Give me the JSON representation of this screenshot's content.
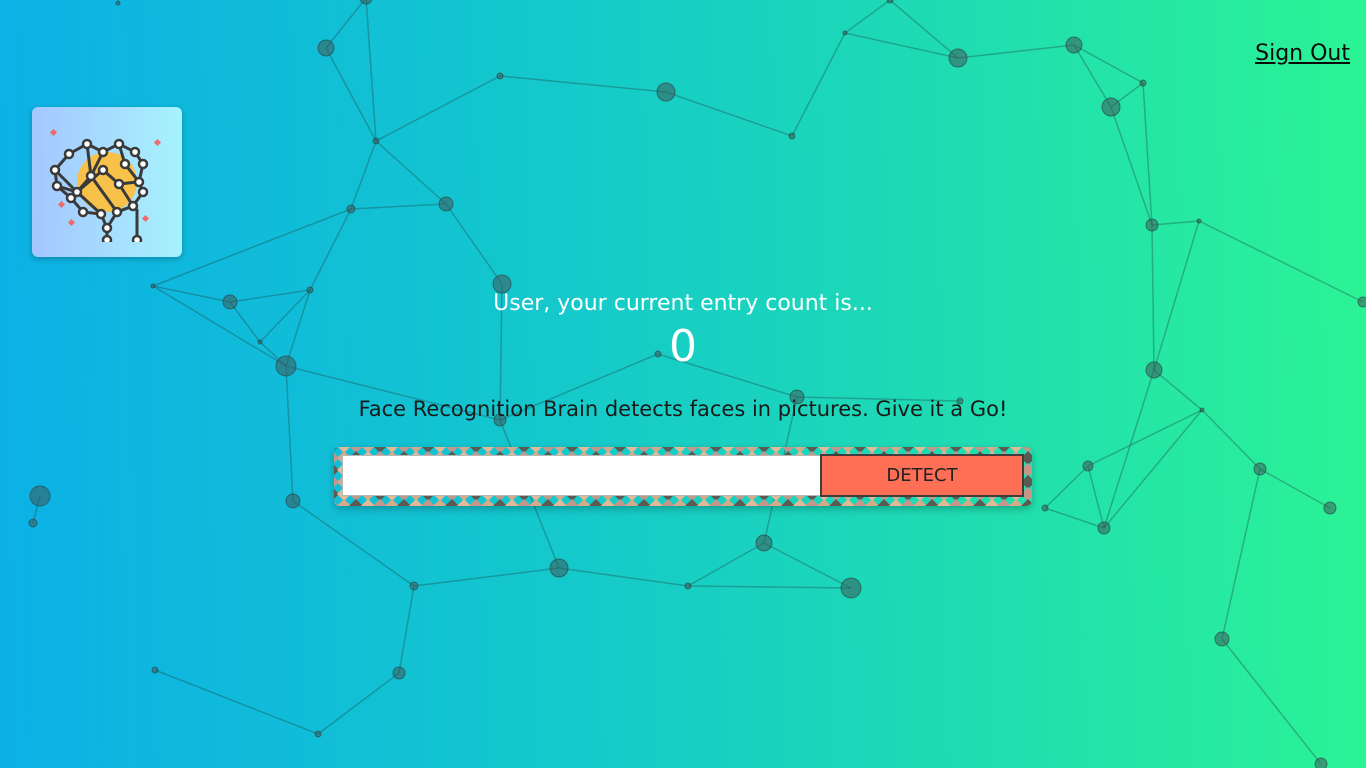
{
  "nav": {
    "sign_out_label": "Sign Out"
  },
  "logo": {
    "icon": "brain-icon"
  },
  "rank": {
    "label": "User, your current entry count is...",
    "count": "0"
  },
  "tagline": "Face Recognition Brain detects faces in pictures. Give it a Go!",
  "image_form": {
    "input_value": "",
    "button_label": "DETECT"
  },
  "colors": {
    "gradient_start": "#0cb0e6",
    "gradient_end": "#2cf395",
    "button": "#ff6f56",
    "logo_card_start": "#a5c6ff",
    "logo_card_end": "#a6f3fe"
  }
}
